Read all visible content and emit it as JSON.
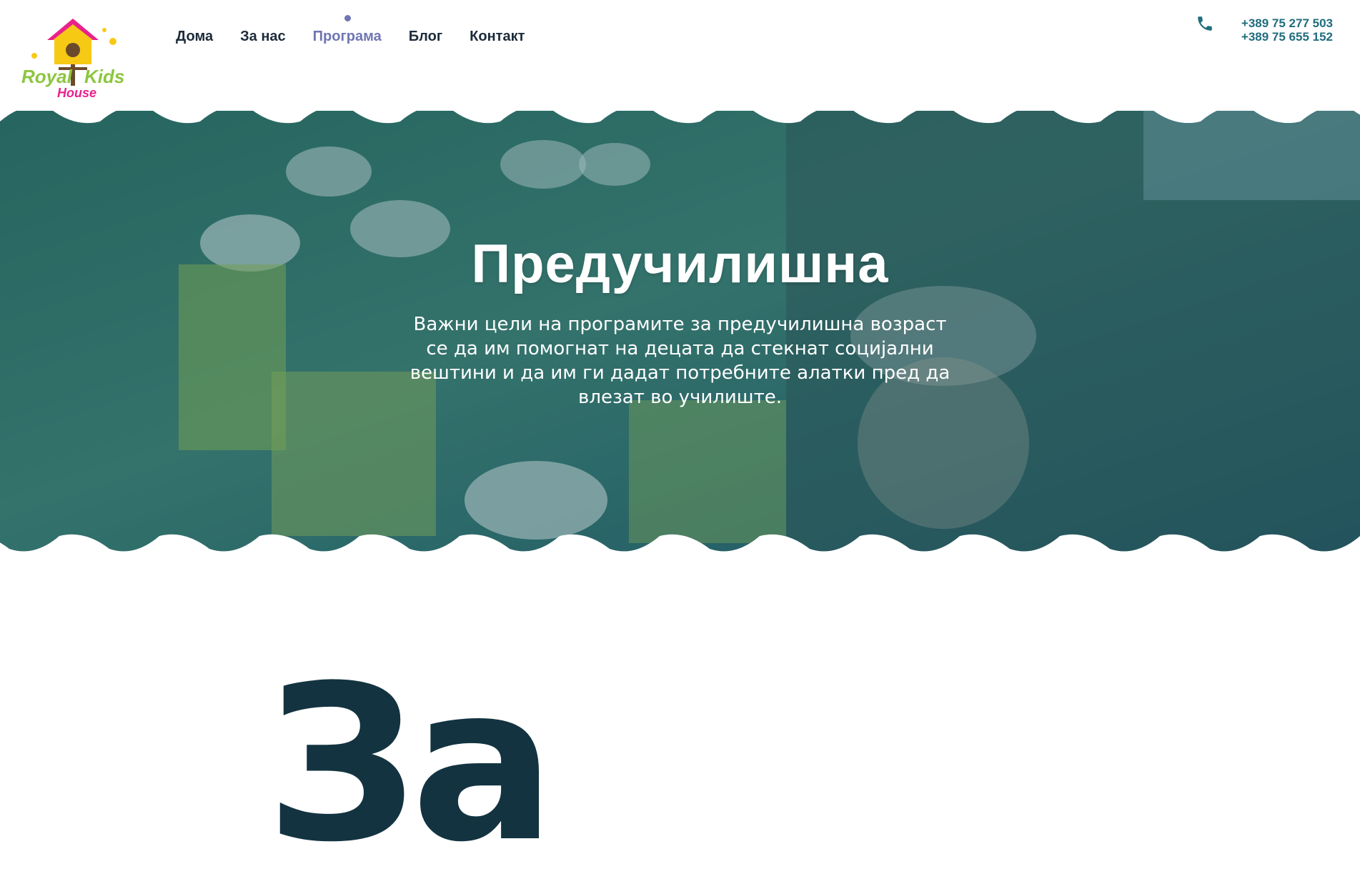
{
  "brand": {
    "logo_word_1": "Royal",
    "logo_word_2": "Kids",
    "logo_word_3": "House",
    "colors": {
      "green": "#8cc63f",
      "pink": "#e8228c",
      "yellow": "#f6c915",
      "teal": "#1f6d7d"
    }
  },
  "nav": {
    "items": [
      {
        "label": "Дома",
        "active": false
      },
      {
        "label": "За нас",
        "active": false
      },
      {
        "label": "Програма",
        "active": true
      },
      {
        "label": "Блог",
        "active": false
      },
      {
        "label": "Контакт",
        "active": false
      }
    ],
    "active_color": "#6f76b4",
    "text_color": "#1d2b3a"
  },
  "contact": {
    "icon": "phone-icon",
    "phones": [
      "+389 75 277 503",
      "+389 75 655 152"
    ]
  },
  "hero": {
    "title": "Предучилишна",
    "description": "Важни цели на програмите за предучилишна возраст се да им помогнат на децата да стекнат социјални вештини и да им ги дадат потребните алатки пред да влезат во училиште.",
    "overlay_color": "#1f5c6a"
  },
  "section": {
    "heading": "За"
  }
}
